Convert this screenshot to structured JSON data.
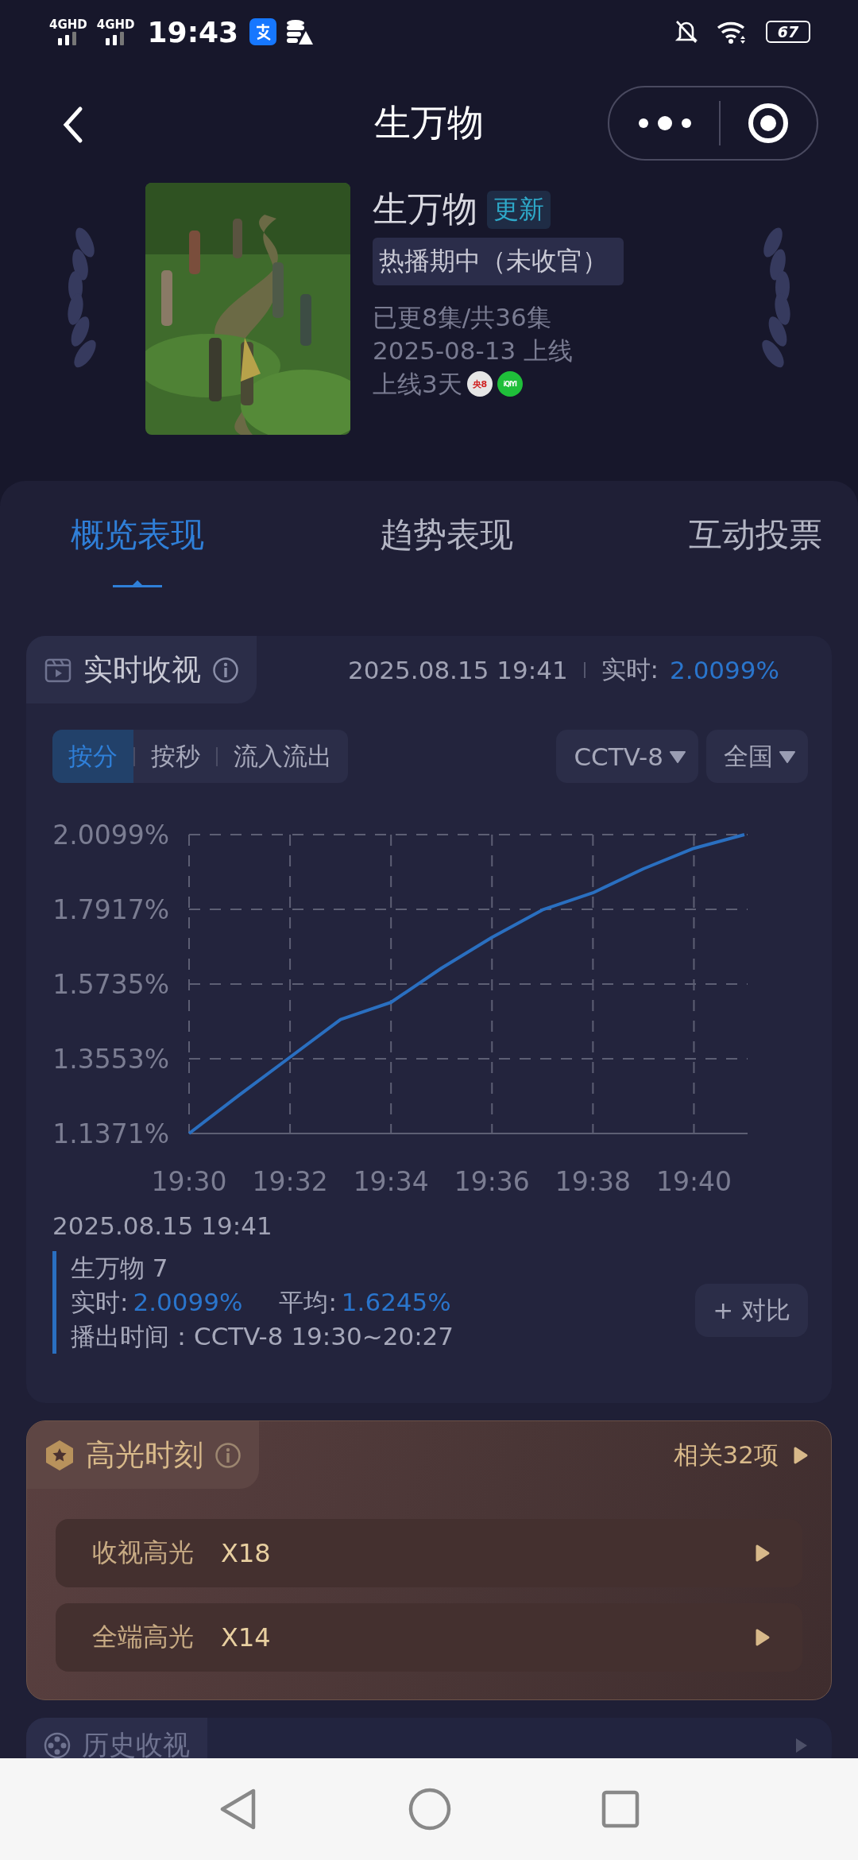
{
  "status_bar": {
    "networks": [
      "4GHD",
      "4GHD"
    ],
    "time": "19:43",
    "battery": "67"
  },
  "header": {
    "title": "生万物"
  },
  "show": {
    "title": "生万物",
    "badge": "更新",
    "status": "热播期中（未收官）",
    "lines": [
      "已更8集/共36集",
      "2025-08-13 上线"
    ],
    "days": "上线3天",
    "platforms": [
      {
        "label": "央8",
        "color": "#e6e6e6"
      },
      {
        "label": "iQIYI",
        "color": "#1fbf3a"
      }
    ]
  },
  "tabs": [
    {
      "label": "概览表现",
      "selected": true
    },
    {
      "label": "趋势表现",
      "selected": false
    },
    {
      "label": "互动投票",
      "selected": false
    }
  ],
  "realtime": {
    "title": "实时收视",
    "timestamp": "2025.08.15 19:41",
    "live_label": "实时:",
    "live_value": "2.0099%",
    "modes": [
      {
        "label": "按分",
        "selected": true
      },
      {
        "label": "按秒",
        "selected": false
      },
      {
        "label": "流入流出",
        "selected": false
      }
    ],
    "dropdowns": [
      "CCTV-8",
      "全国"
    ],
    "chart_data": {
      "type": "line",
      "grid": true,
      "categories": [
        "19:30",
        null,
        "19:32",
        null,
        "19:34",
        null,
        "19:36",
        null,
        "19:38",
        null,
        "19:40",
        null
      ],
      "series": [
        {
          "color": "#2a6fc0",
          "values": [
            1.1371,
            1.25,
            1.36,
            1.47,
            1.52,
            1.62,
            1.71,
            1.79,
            1.84,
            1.91,
            1.97,
            2.0099
          ]
        }
      ],
      "ylim": [
        1.1371,
        2.0099
      ],
      "yticks": [
        {
          "value": 1.1371,
          "label": "1.1371%"
        },
        {
          "value": 1.3553,
          "label": "1.3553%"
        },
        {
          "value": 1.5735,
          "label": "1.5735%"
        },
        {
          "value": 1.7917,
          "label": "1.7917%"
        },
        {
          "value": 2.0099,
          "label": "2.0099%"
        }
      ]
    },
    "detail": {
      "date": "2025.08.15 19:41",
      "name": "生万物 7",
      "live_label": "实时:",
      "live_value": "2.0099%",
      "avg_label": "平均:",
      "avg_value": "1.6245%",
      "airtime": "播出时间：CCTV-8 19:30~20:27"
    },
    "compare_button": "+ 对比"
  },
  "highlights": {
    "title": "高光时刻",
    "related": "相关32项",
    "items": [
      {
        "label": "收视高光",
        "count": "X18"
      },
      {
        "label": "全端高光",
        "count": "X14"
      }
    ]
  },
  "history": {
    "title": "历史收视"
  }
}
